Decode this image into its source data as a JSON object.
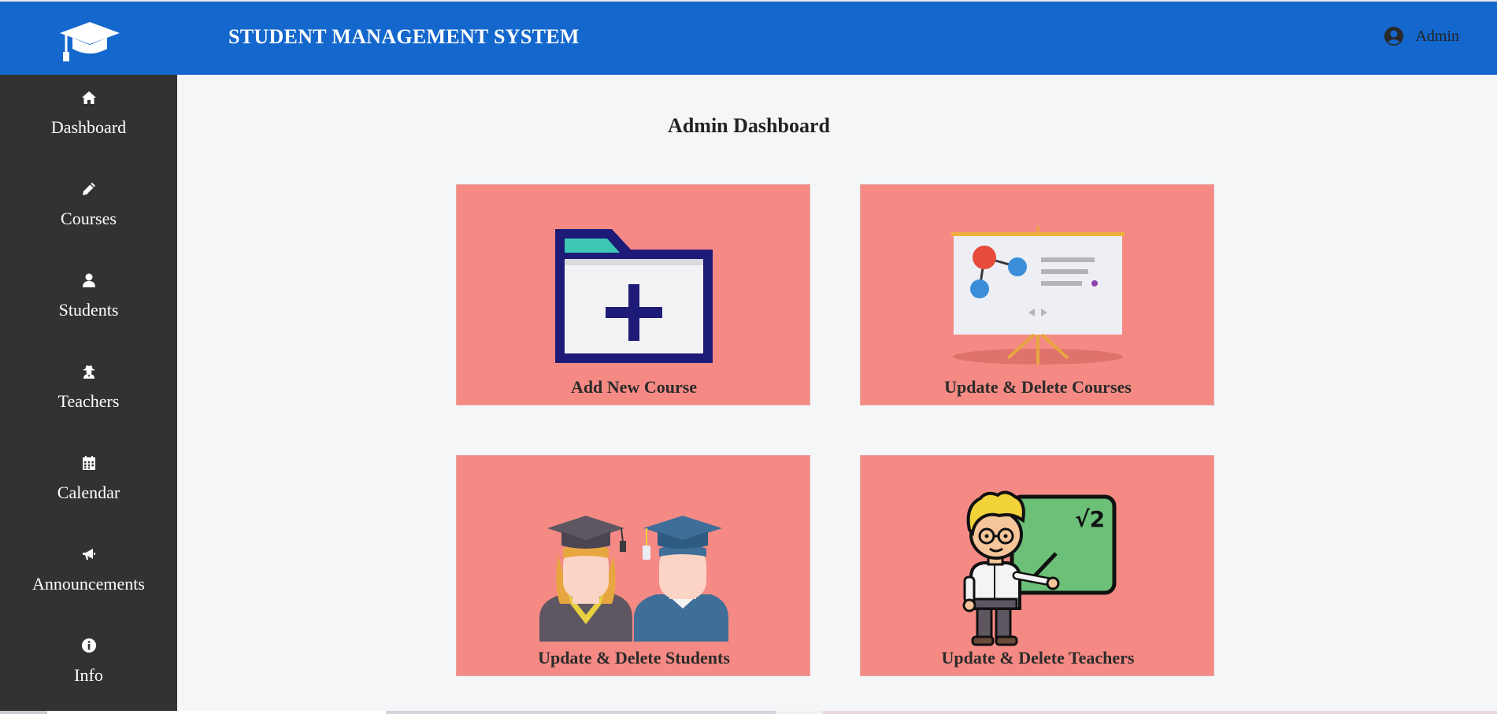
{
  "header": {
    "app_title": "STUDENT MANAGEMENT SYSTEM",
    "user_label": "Admin",
    "logo_icon": "graduation-cap-icon",
    "user_icon": "user-circle-icon"
  },
  "sidebar": {
    "items": [
      {
        "label": "Dashboard",
        "icon": "home-icon"
      },
      {
        "label": "Courses",
        "icon": "pencil-icon"
      },
      {
        "label": "Students",
        "icon": "user-icon"
      },
      {
        "label": "Teachers",
        "icon": "user-secret-icon"
      },
      {
        "label": "Calendar",
        "icon": "calendar-icon"
      },
      {
        "label": "Announcements",
        "icon": "bullhorn-icon"
      },
      {
        "label": "Info",
        "icon": "info-circle-icon"
      }
    ]
  },
  "main": {
    "title": "Admin Dashboard",
    "cards": [
      {
        "label": "Add New Course",
        "icon": "folder-add-icon"
      },
      {
        "label": "Update & Delete Courses",
        "icon": "presentation-board-icon"
      },
      {
        "label": "Update & Delete Students",
        "icon": "graduates-icon"
      },
      {
        "label": "Update & Delete Teachers",
        "icon": "teacher-blackboard-icon"
      }
    ]
  },
  "colors": {
    "header_bg": "#1467cc",
    "sidebar_bg": "#323232",
    "main_bg": "#f5f6f8",
    "card_bg": "#f58a84"
  }
}
